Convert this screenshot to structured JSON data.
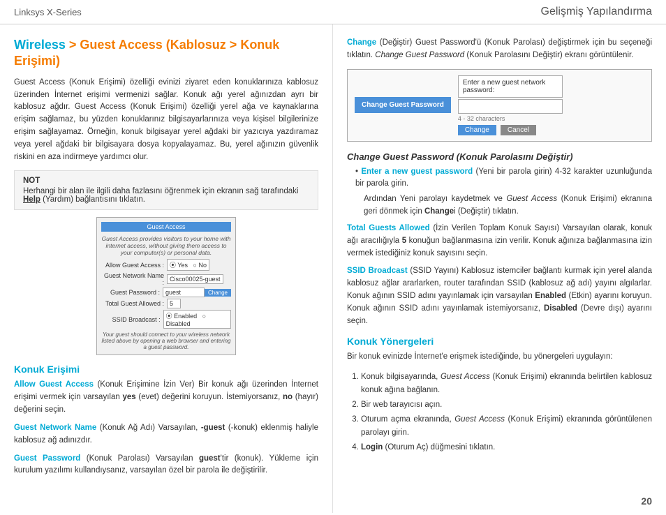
{
  "header": {
    "left": "Linksys X-Series",
    "right": "Gelişmiş Yapılandırma"
  },
  "page_number": "20",
  "left_col": {
    "title_part1": "Wireless",
    "title_part2": " > Guest Access (Kablosuz > Konuk Erişimi)",
    "intro_text": "Guest Access (Konuk Erişimi) özelliği evinizi ziyaret eden konuklarınıza kablosuz üzerinden İnternet erişimi vermenizi sağlar. Konuk ağı yerel ağınızdan ayrı bir kablosuz ağdır. Guest Access (Konuk Erişimi) özelliği yerel ağa ve kaynaklarına erişim sağlamaz, bu yüzden konuklarınız bilgisayarlarınıza veya kişisel bilgilerinize erişim sağlayamaz. Örneğin, konuk bilgisayar yerel ağdaki bir yazıcıya yazdıramaz veya yerel ağdaki bir bilgisayara dosya kopyalayamaz. Bu, yerel ağınızın güvenlik riskini en aza indirmeye yardımcı olur.",
    "note_label": "NOT",
    "note_text": "Herhangi bir alan ile ilgili daha fazlasını öğrenmek için ekranın sağ tarafındaki ",
    "note_help": "Help",
    "note_text2": " (Yardım) bağlantısını tıklatın.",
    "screenshot": {
      "title": "Guest Access",
      "desc": "Guest Access provides visitors to your home with internet access, without giving them access to your computer(s) or personal data.",
      "rows": [
        {
          "label": "Allow Guest Access :",
          "value": "Yes  No",
          "has_radio": true
        },
        {
          "label": "Guest Network Name :",
          "value": "Cisco00025-guest"
        },
        {
          "label": "Guest Password :",
          "value": "guest",
          "has_change": true
        },
        {
          "label": "Total Guest Allowed :",
          "value": "5"
        },
        {
          "label": "SSID Broadcast :",
          "value": "Enabled  Disabled",
          "has_radio": true
        }
      ],
      "footer": "Your guest should connect to your wireless network listed above by opening a web browser and entering a guest password."
    },
    "section_konuk": "Konuk Erişimi",
    "allow_guest_title": "Allow Guest Access",
    "allow_guest_text": " (Konuk Erişimine İzin Ver) Bir konuk ağı üzerinden İnternet erişimi vermek için varsayılan ",
    "allow_yes": "yes",
    "allow_text2": " (evet) değerini koruyun. İstemiyorsanız, ",
    "allow_no": "no",
    "allow_text3": " (hayır) değerini seçin.",
    "network_name_title": "Guest Network Name",
    "network_name_text": " (Konuk Ağ Adı)  Varsayılan, ",
    "network_name_val": "-guest",
    "network_name_text2": " (-konuk) eklenmiş haliyle kablosuz ağ adınızdır.",
    "guest_pwd_title": "Guest Password",
    "guest_pwd_text": " (Konuk Parolası)  Varsayılan ",
    "guest_pwd_val": "guest",
    "guest_pwd_text2": "'tir (konuk). Yükleme için kurulum yazılımı kullandıysanız, varsayılan özel bir parola ile değiştirilir."
  },
  "right_col": {
    "change_intro": "Change",
    "change_intro_text": " (Değiştir) Guest Password'ü (Konuk Parolası) değiştirmek için bu seçeneği tıklatın. ",
    "change_guest_pwd": "Change Guest Password",
    "change_text2": " (Konuk Parolasını Değiştir) ekranı görüntülenir.",
    "pwd_box": {
      "left_label": "Change Guest Password",
      "right_label": "Enter a new guest network password:",
      "char_hint": "4 - 32 characters",
      "change_btn": "Change",
      "cancel_btn": "Cancel"
    },
    "change_pwd_section_title": "Change Guest Password (Konuk Parolasını Değiştir)",
    "enter_pwd_bullet": "Enter a new guest password",
    "enter_pwd_text": " (Yeni bir parola girin) 4-32 karakter uzunluğunda bir parola girin.",
    "sub_text": "Ardından Yeni parolayı kaydetmek ve ",
    "sub_guest": "Guest Access",
    "sub_text2": " (Konuk Erişimi) ekranına geri dönmek için ",
    "sub_change": "Change",
    "sub_text3": "i (Değiştir) tıklatın.",
    "total_guests_title": "Total Guests Allowed",
    "total_guests_text": " (İzin Verilen Toplam Konuk Sayısı)  Varsayılan olarak, konuk ağı aracılığıyla ",
    "total_guests_num": "5",
    "total_guests_text2": " konuğun bağlanmasına izin verilir. Konuk ağınıza bağlanmasına izin vermek istediğiniz konuk sayısını seçin.",
    "ssid_title": "SSID Broadcast",
    "ssid_text": " (SSID Yayını)  Kablosuz istemciler bağlantı kurmak için yerel alanda kablosuz ağlar ararlarken, router tarafından SSID (kablosuz ağ adı) yayını algılarlar. Konuk ağının SSID adını yayınlamak için varsayılan ",
    "ssid_enabled": "Enabled",
    "ssid_text2": " (Etkin) ayarını koruyun. Konuk ağının SSID adını yayınlamak istemiyorsanız, ",
    "ssid_disabled": "Disabled",
    "ssid_text3": " (Devre dışı) ayarını seçin.",
    "tips_title": "Konuk Yönergeleri",
    "tips_intro": "Bir konuk evinizde İnternet'e erişmek istediğinde, bu yönergeleri uygulayın:",
    "tips": [
      "Konuk bilgisayarında, Guest Access (Konuk Erişimi) ekranında belirtilen kablosuz konuk ağına bağlanın.",
      "Bir web tarayıcısı açın.",
      "Oturum açma ekranında, Guest Access (Konuk Erişimi) ekranında görüntülenen parolayı girin.",
      "Login (Oturum Aç) düğmesini tıklatın."
    ]
  }
}
